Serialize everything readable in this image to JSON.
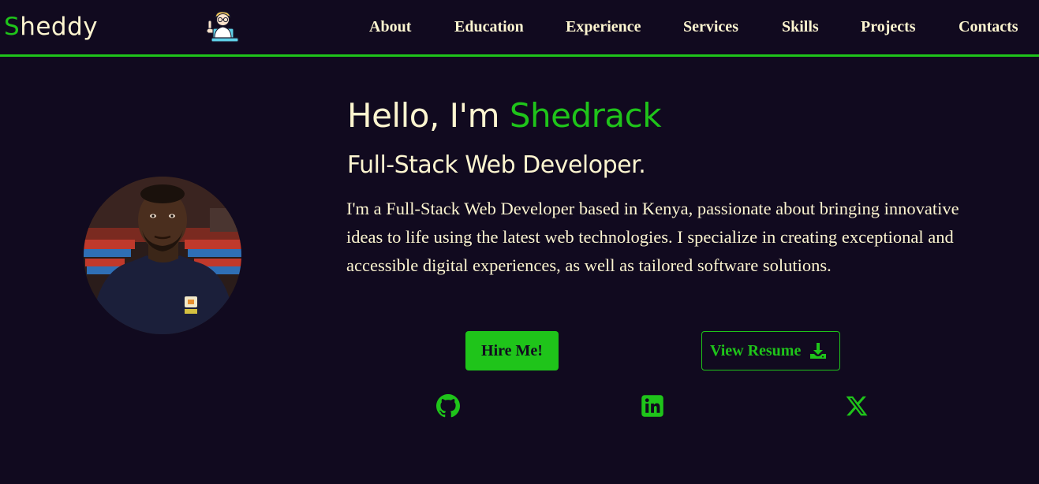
{
  "brand": {
    "logo_first_letter": "S",
    "logo_rest": "heddy",
    "mascot_icon": "developer-mascot-icon"
  },
  "nav": {
    "items": [
      {
        "label": "About"
      },
      {
        "label": "Education"
      },
      {
        "label": "Experience"
      },
      {
        "label": "Services"
      },
      {
        "label": "Skills"
      },
      {
        "label": "Projects"
      },
      {
        "label": "Contacts"
      }
    ]
  },
  "hero": {
    "greeting": "Hello, I'm ",
    "name": "Shedrack",
    "subtitle": "Full-Stack Web Developer.",
    "description": "I'm a Full-Stack Web Developer based in Kenya, passionate about bringing innovative ideas to life using the latest web technologies. I specialize in creating exceptional and accessible digital experiences, as well as tailored software solutions.",
    "hire_label": "Hire Me!",
    "resume_label": "View Resume",
    "resume_icon": "download-icon"
  },
  "social": [
    {
      "icon": "github-icon"
    },
    {
      "icon": "linkedin-icon"
    },
    {
      "icon": "x-twitter-icon"
    }
  ],
  "colors": {
    "background": "#110a1f",
    "accent": "#1fc41a",
    "text": "#fdf5d0"
  }
}
